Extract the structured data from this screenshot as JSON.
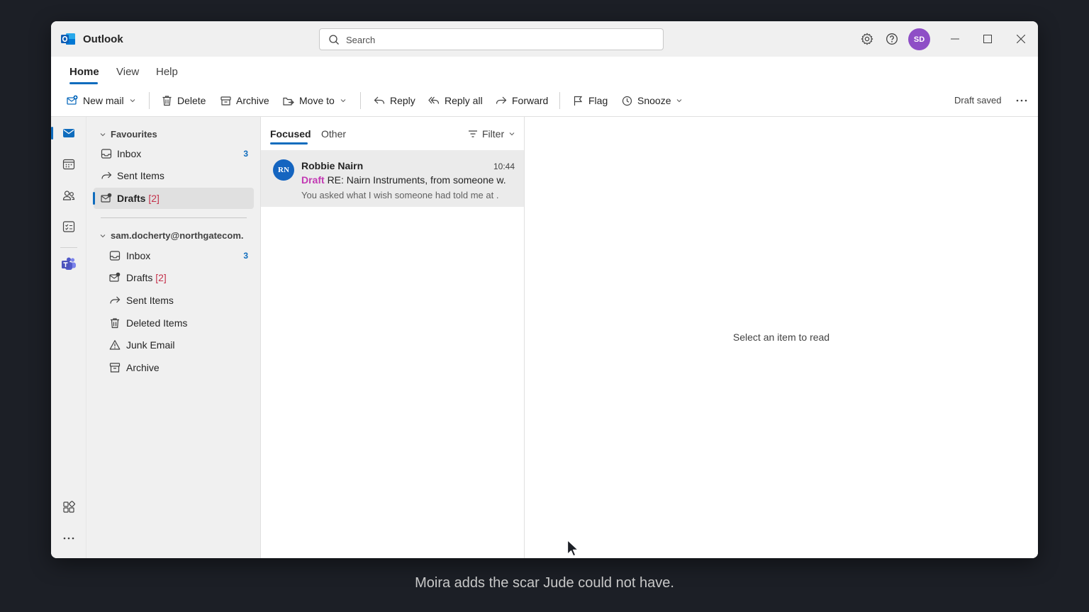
{
  "app": {
    "name": "Outlook",
    "brand_color": "#0f6cbd",
    "logo_icon": "outlook-logo-icon"
  },
  "search": {
    "placeholder": "Search"
  },
  "titlebar": {
    "avatar_initials": "SD",
    "avatar_color": "#8e4ec6",
    "icons": [
      "settings-icon",
      "help-icon",
      "minimize-icon",
      "maximize-icon",
      "close-icon"
    ]
  },
  "menu": {
    "tabs": [
      {
        "label": "Home",
        "active": true
      },
      {
        "label": "View"
      },
      {
        "label": "Help"
      }
    ]
  },
  "toolbar": {
    "new_mail": "New mail",
    "delete": "Delete",
    "archive": "Archive",
    "move_to": "Move to",
    "reply": "Reply",
    "reply_all": "Reply all",
    "forward": "Forward",
    "flag": "Flag",
    "snooze": "Snooze",
    "status": "Draft saved",
    "more": "More options"
  },
  "rail": {
    "items": [
      "mail-icon",
      "calendar-icon",
      "people-icon",
      "tasks-icon",
      "teams-icon",
      "apps-icon",
      "more-icon"
    ]
  },
  "favourites": {
    "heading": "Favourites",
    "items": [
      {
        "label": "Inbox",
        "count": "3"
      },
      {
        "label": "Sent Items"
      },
      {
        "label": "Drafts",
        "count": "[2]",
        "selected": true
      }
    ]
  },
  "account": {
    "heading": "sam.docherty@northgatecom.",
    "items": [
      {
        "label": "Inbox",
        "count": "3"
      },
      {
        "label": "Drafts",
        "count": "[2]"
      },
      {
        "label": "Sent Items"
      },
      {
        "label": "Deleted Items"
      },
      {
        "label": "Junk Email"
      },
      {
        "label": "Archive"
      }
    ]
  },
  "list": {
    "tabs": [
      {
        "label": "Focused",
        "active": true
      },
      {
        "label": "Other"
      }
    ],
    "filter": "Filter",
    "messages": [
      {
        "initials": "RN",
        "sender": "Robbie Nairn",
        "time": "10:44",
        "draft_tag": "Draft",
        "subject": "RE: Nairn Instruments, from someone w.",
        "preview": "You asked what I wish someone had told me at ."
      }
    ]
  },
  "reading": {
    "empty": "Select an item to read"
  },
  "caption": "Moira adds the scar Jude could not have."
}
